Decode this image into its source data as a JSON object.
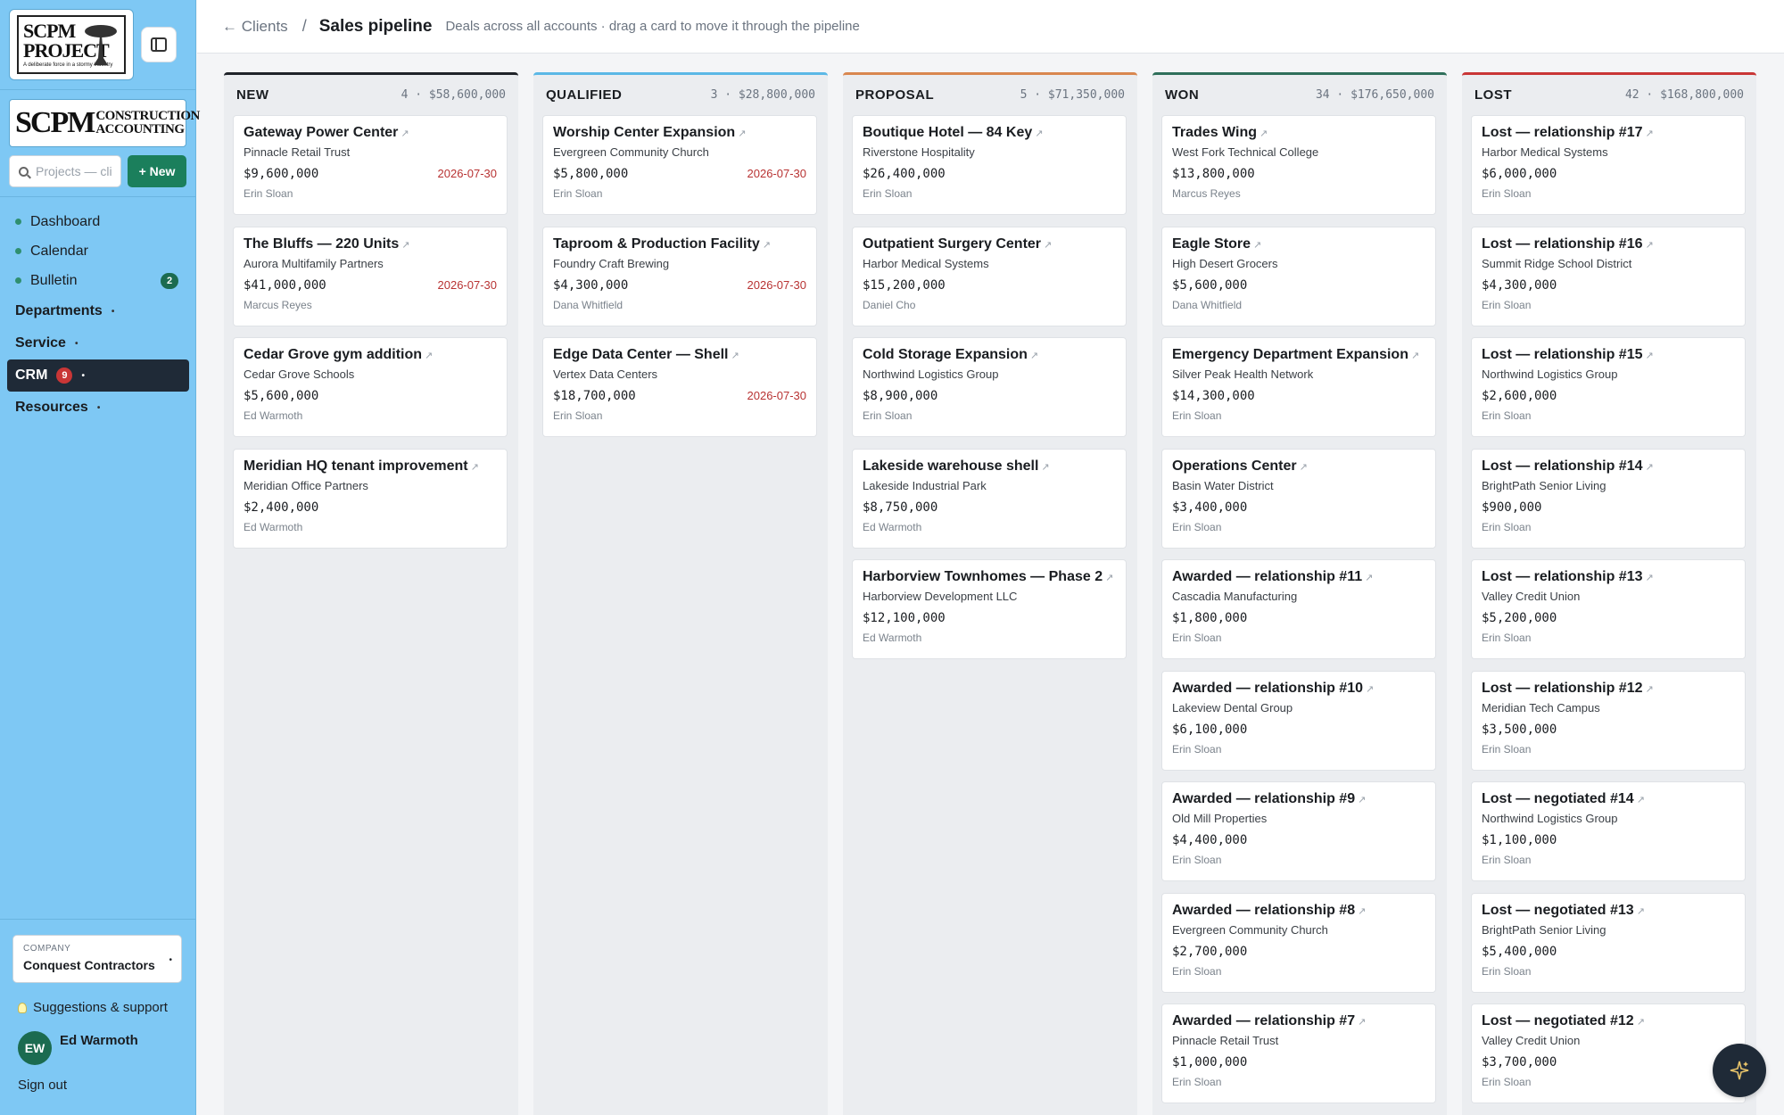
{
  "sidebar": {
    "logo": {
      "line1": "SCPM",
      "line2": "PROJECT",
      "tagline": "A deliberate force in a stormy industry"
    },
    "brand2": {
      "big": "SCPM",
      "small1": "CONSTRUCTION",
      "small2": "ACCOUNTING"
    },
    "search_placeholder": "Projects — clients",
    "new_label": "+ New",
    "nav_items": [
      {
        "label": "Dashboard"
      },
      {
        "label": "Calendar"
      },
      {
        "label": "Bulletin",
        "badge": "2"
      }
    ],
    "groups": [
      {
        "label": "Departments"
      },
      {
        "label": "Service"
      },
      {
        "label": "CRM",
        "badge": "9"
      },
      {
        "label": "Resources"
      }
    ],
    "company_label": "COMPANY",
    "company_value": "Conquest Contractors",
    "support_label": "Suggestions & support",
    "user_initials": "EW",
    "user_name": "Ed Warmoth",
    "signout_label": "Sign out"
  },
  "header": {
    "back_label": "← Clients",
    "separator": "/",
    "title": "Sales pipeline",
    "subtitle": "Deals across all accounts · drag a card to move it through the pipeline"
  },
  "colors": {
    "NEW": "#1f2329",
    "QUALIFIED": "#5bb8e6",
    "PROPOSAL": "#d9874f",
    "WON": "#2f6f5a",
    "LOST": "#c93636"
  },
  "columns": [
    {
      "name": "NEW",
      "stats": "4 · $58,600,000",
      "cards": [
        {
          "name": "Gateway Power Center",
          "client": "Pinnacle Retail Trust",
          "value": "$9,600,000",
          "date": "2026-07-30",
          "owner": "Erin Sloan"
        },
        {
          "name": "The Bluffs — 220 Units",
          "client": "Aurora Multifamily Partners",
          "value": "$41,000,000",
          "date": "2026-07-30",
          "owner": "Marcus Reyes"
        },
        {
          "name": "Cedar Grove gym addition",
          "client": "Cedar Grove Schools",
          "value": "$5,600,000",
          "date": "",
          "owner": "Ed Warmoth"
        },
        {
          "name": "Meridian HQ tenant improvement",
          "client": "Meridian Office Partners",
          "value": "$2,400,000",
          "date": "",
          "owner": "Ed Warmoth"
        }
      ]
    },
    {
      "name": "QUALIFIED",
      "stats": "3 · $28,800,000",
      "cards": [
        {
          "name": "Worship Center Expansion",
          "client": "Evergreen Community Church",
          "value": "$5,800,000",
          "date": "2026-07-30",
          "owner": "Erin Sloan"
        },
        {
          "name": "Taproom & Production Facility",
          "client": "Foundry Craft Brewing",
          "value": "$4,300,000",
          "date": "2026-07-30",
          "owner": "Dana Whitfield"
        },
        {
          "name": "Edge Data Center — Shell",
          "client": "Vertex Data Centers",
          "value": "$18,700,000",
          "date": "2026-07-30",
          "owner": "Erin Sloan"
        }
      ]
    },
    {
      "name": "PROPOSAL",
      "stats": "5 · $71,350,000",
      "cards": [
        {
          "name": "Boutique Hotel — 84 Key",
          "client": "Riverstone Hospitality",
          "value": "$26,400,000",
          "date": "",
          "owner": "Erin Sloan"
        },
        {
          "name": "Outpatient Surgery Center",
          "client": "Harbor Medical Systems",
          "value": "$15,200,000",
          "date": "",
          "owner": "Daniel Cho"
        },
        {
          "name": "Cold Storage Expansion",
          "client": "Northwind Logistics Group",
          "value": "$8,900,000",
          "date": "",
          "owner": "Erin Sloan"
        },
        {
          "name": "Lakeside warehouse shell",
          "client": "Lakeside Industrial Park",
          "value": "$8,750,000",
          "date": "",
          "owner": "Ed Warmoth"
        },
        {
          "name": "Harborview Townhomes — Phase 2",
          "client": "Harborview Development LLC",
          "value": "$12,100,000",
          "date": "",
          "owner": "Ed Warmoth"
        }
      ]
    },
    {
      "name": "WON",
      "stats": "34 · $176,650,000",
      "cards": [
        {
          "name": "Trades Wing",
          "client": "West Fork Technical College",
          "value": "$13,800,000",
          "date": "",
          "owner": "Marcus Reyes"
        },
        {
          "name": "Eagle Store",
          "client": "High Desert Grocers",
          "value": "$5,600,000",
          "date": "",
          "owner": "Dana Whitfield"
        },
        {
          "name": "Emergency Department Expansion",
          "client": "Silver Peak Health Network",
          "value": "$14,300,000",
          "date": "",
          "owner": "Erin Sloan"
        },
        {
          "name": "Operations Center",
          "client": "Basin Water District",
          "value": "$3,400,000",
          "date": "",
          "owner": "Erin Sloan"
        },
        {
          "name": "Awarded — relationship #11",
          "client": "Cascadia Manufacturing",
          "value": "$1,800,000",
          "date": "",
          "owner": "Erin Sloan"
        },
        {
          "name": "Awarded — relationship #10",
          "client": "Lakeview Dental Group",
          "value": "$6,100,000",
          "date": "",
          "owner": "Erin Sloan"
        },
        {
          "name": "Awarded — relationship #9",
          "client": "Old Mill Properties",
          "value": "$4,400,000",
          "date": "",
          "owner": "Erin Sloan"
        },
        {
          "name": "Awarded — relationship #8",
          "client": "Evergreen Community Church",
          "value": "$2,700,000",
          "date": "",
          "owner": "Erin Sloan"
        },
        {
          "name": "Awarded — relationship #7",
          "client": "Pinnacle Retail Trust",
          "value": "$1,000,000",
          "date": "",
          "owner": "Erin Sloan"
        }
      ]
    },
    {
      "name": "LOST",
      "stats": "42 · $168,800,000",
      "cards": [
        {
          "name": "Lost — relationship #17",
          "client": "Harbor Medical Systems",
          "value": "$6,000,000",
          "date": "",
          "owner": "Erin Sloan"
        },
        {
          "name": "Lost — relationship #16",
          "client": "Summit Ridge School District",
          "value": "$4,300,000",
          "date": "",
          "owner": "Erin Sloan"
        },
        {
          "name": "Lost — relationship #15",
          "client": "Northwind Logistics Group",
          "value": "$2,600,000",
          "date": "",
          "owner": "Erin Sloan"
        },
        {
          "name": "Lost — relationship #14",
          "client": "BrightPath Senior Living",
          "value": "$900,000",
          "date": "",
          "owner": "Erin Sloan"
        },
        {
          "name": "Lost — relationship #13",
          "client": "Valley Credit Union",
          "value": "$5,200,000",
          "date": "",
          "owner": "Erin Sloan"
        },
        {
          "name": "Lost — relationship #12",
          "client": "Meridian Tech Campus",
          "value": "$3,500,000",
          "date": "",
          "owner": "Erin Sloan"
        },
        {
          "name": "Lost — negotiated #14",
          "client": "Northwind Logistics Group",
          "value": "$1,100,000",
          "date": "",
          "owner": "Erin Sloan"
        },
        {
          "name": "Lost — negotiated #13",
          "client": "BrightPath Senior Living",
          "value": "$5,400,000",
          "date": "",
          "owner": "Erin Sloan"
        },
        {
          "name": "Lost — negotiated #12",
          "client": "Valley Credit Union",
          "value": "$3,700,000",
          "date": "",
          "owner": "Erin Sloan"
        }
      ]
    }
  ]
}
